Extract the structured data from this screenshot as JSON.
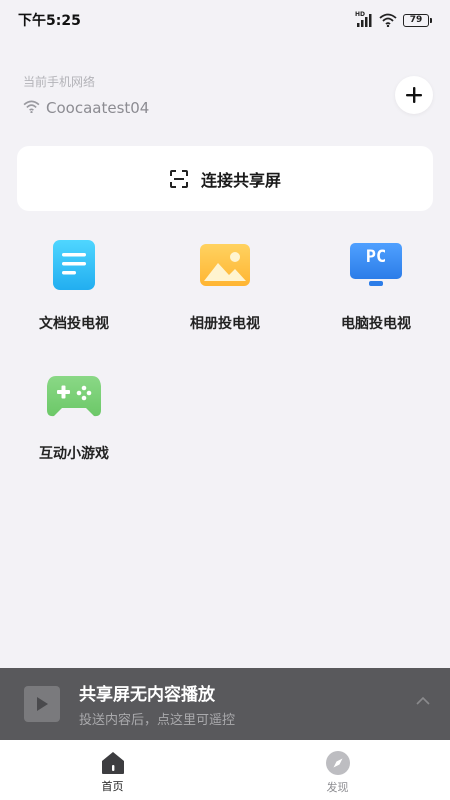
{
  "status_bar": {
    "time": "下午5:25",
    "signal_label": "HD",
    "battery": "79"
  },
  "network": {
    "label": "当前手机网络",
    "name": "Coocaatest04"
  },
  "connect": {
    "label": "连接共享屏"
  },
  "features": [
    {
      "label": "文档投电视",
      "icon": "document-icon",
      "color": "#35c8f5"
    },
    {
      "label": "相册投电视",
      "icon": "photo-icon",
      "color": "#ffc64a"
    },
    {
      "label": "电脑投电视",
      "icon": "pc-monitor-icon",
      "color": "#3a8ef0",
      "badge": "PC"
    },
    {
      "label": "互动小游戏",
      "icon": "gamepad-icon",
      "color": "#7ed07a"
    }
  ],
  "mini_player": {
    "title": "共享屏无内容播放",
    "subtitle": "投送内容后，点这里可遥控"
  },
  "tabs": [
    {
      "label": "首页",
      "active": true
    },
    {
      "label": "发现",
      "active": false
    }
  ]
}
